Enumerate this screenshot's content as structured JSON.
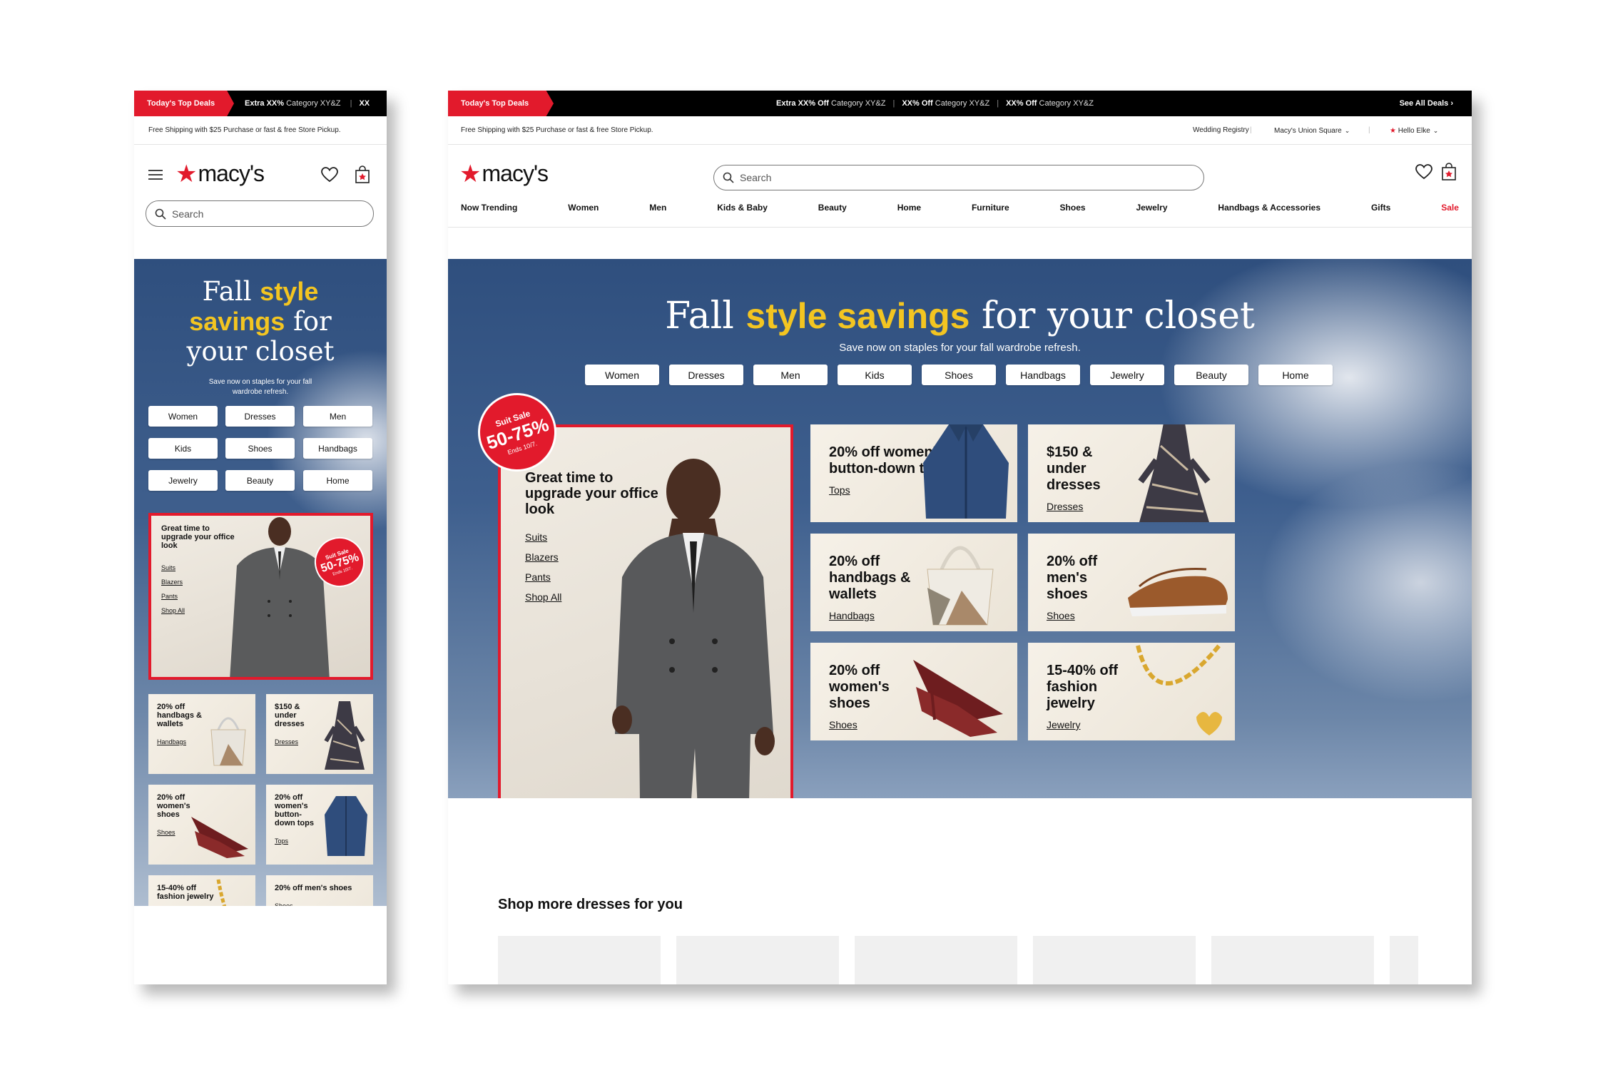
{
  "deals": {
    "tag": "Today's Top Deals",
    "items": [
      {
        "offer": "Extra XX% Off",
        "category": "Category XY&Z"
      },
      {
        "offer": "XX% Off",
        "category": "Category XY&Z"
      },
      {
        "offer": "XX% Off",
        "category": "Category XY&Z"
      }
    ],
    "mobile_offer": "Extra XX%",
    "mobile_category": "Category XY&Z",
    "mobile_cut": "XX",
    "see_all": "See All Deals"
  },
  "shipping_text": "Free Shipping with $25 Purchase or fast & free Store Pickup.",
  "utility": {
    "registry": "Wedding Registry",
    "store": "Macy's Union Square",
    "greeting": "Hello Elke"
  },
  "brand": {
    "name": "macy's",
    "star": "★"
  },
  "search": {
    "placeholder": "Search"
  },
  "nav": [
    "Now Trending",
    "Women",
    "Men",
    "Kids & Baby",
    "Beauty",
    "Home",
    "Furniture",
    "Shoes",
    "Jewelry",
    "Handbags & Accessories",
    "Gifts",
    "Sale"
  ],
  "hero": {
    "title_pre": "Fall ",
    "title_hl": "style savings",
    "title_post": " for your closet",
    "m_title_l1_pre": "Fall ",
    "m_title_l1_hl": "style",
    "m_title_l2_hl": "savings",
    "m_title_l2_post": " for",
    "m_title_l3": "your closet",
    "subtitle": "Save now on staples for your fall wardrobe refresh.",
    "pills_desktop": [
      "Women",
      "Dresses",
      "Men",
      "Kids",
      "Shoes",
      "Handbags",
      "Jewelry",
      "Beauty",
      "Home"
    ],
    "pills_mobile": [
      "Women",
      "Dresses",
      "Men",
      "Kids",
      "Shoes",
      "Handbags",
      "Jewelry",
      "Beauty",
      "Home"
    ]
  },
  "feature": {
    "title": "Great time to upgrade your office look",
    "links": [
      "Suits",
      "Blazers",
      "Pants",
      "Shop All"
    ],
    "badge": {
      "line1": "Suit Sale",
      "line2": "50-75%",
      "line3": "Ends 10/7."
    }
  },
  "cards": {
    "tops": {
      "title": "20% off women's button-down tops",
      "link": "Tops"
    },
    "dresses": {
      "title": "$150 & under dresses",
      "link": "Dresses"
    },
    "handbags": {
      "title": "20% off handbags & wallets",
      "link": "Handbags"
    },
    "mens_shoes": {
      "title": "20% off men's shoes",
      "link": "Shoes"
    },
    "womens_shoes": {
      "title": "20% off women's shoes",
      "link": "Shoes"
    },
    "jewelry": {
      "title": "15-40% off fashion jewelry",
      "link": "Jewelry"
    }
  },
  "more_title": "Shop more dresses for you",
  "colors": {
    "brand_red": "#e21a2c",
    "highlight_yellow": "#f3c521",
    "hero_blue": "#2f4f7e"
  }
}
